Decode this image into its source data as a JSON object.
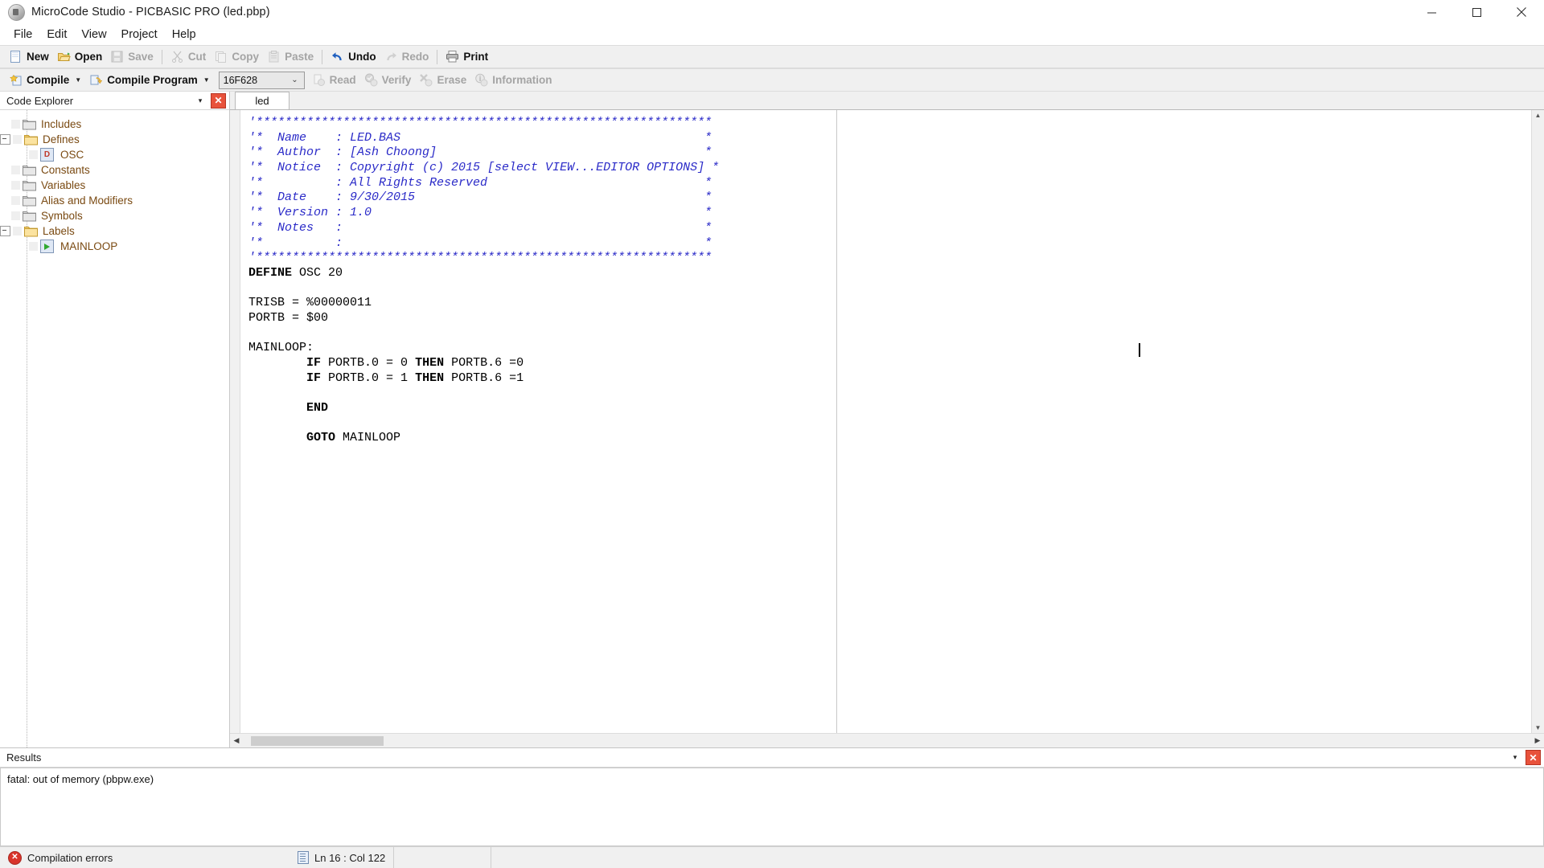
{
  "window": {
    "title": "MicroCode Studio - PICBASIC PRO (led.pbp)",
    "icon": "app-icon",
    "controls": {
      "minimize": "minimize-icon",
      "maximize": "maximize-icon",
      "close": "close-icon"
    }
  },
  "menubar": {
    "items": [
      {
        "label": "File"
      },
      {
        "label": "Edit"
      },
      {
        "label": "View"
      },
      {
        "label": "Project"
      },
      {
        "label": "Help"
      }
    ]
  },
  "toolbar_main": {
    "items": [
      {
        "label": "New",
        "icon": "new-file-icon",
        "enabled": true
      },
      {
        "label": "Open",
        "icon": "open-folder-icon",
        "enabled": true
      },
      {
        "label": "Save",
        "icon": "save-disk-icon",
        "enabled": false
      },
      {
        "sep": true
      },
      {
        "label": "Cut",
        "icon": "scissors-icon",
        "enabled": false
      },
      {
        "label": "Copy",
        "icon": "copy-icon",
        "enabled": false
      },
      {
        "label": "Paste",
        "icon": "clipboard-icon",
        "enabled": false
      },
      {
        "sep": true
      },
      {
        "label": "Undo",
        "icon": "undo-arrow-icon",
        "enabled": true
      },
      {
        "label": "Redo",
        "icon": "redo-arrow-icon",
        "enabled": false
      },
      {
        "sep": true
      },
      {
        "label": "Print",
        "icon": "printer-icon",
        "enabled": true
      }
    ]
  },
  "toolbar_compile": {
    "compile_label": "Compile",
    "compile_icon": "compile-icon",
    "compile_program_label": "Compile Program",
    "compile_program_icon": "compile-program-icon",
    "device_value": "16F628",
    "device_caret": "chevron-down-icon",
    "items": [
      {
        "label": "Read",
        "icon": "read-icon",
        "enabled": false
      },
      {
        "label": "Verify",
        "icon": "verify-check-icon",
        "enabled": false
      },
      {
        "label": "Erase",
        "icon": "erase-x-icon",
        "enabled": false
      },
      {
        "label": "Information",
        "icon": "information-icon",
        "enabled": false
      }
    ]
  },
  "explorer": {
    "title": "Code Explorer",
    "menu_icon": "chevron-down-icon",
    "close_icon": "close-icon",
    "close_label": "✕",
    "tree": [
      {
        "label": "Includes",
        "depth": 1,
        "twisty": "none",
        "icon": "folder-closed-icon"
      },
      {
        "label": "Defines",
        "depth": 1,
        "twisty": "expanded",
        "icon": "folder-open-icon"
      },
      {
        "label": "OSC",
        "depth": 2,
        "twisty": "none",
        "icon": "define-badge-icon"
      },
      {
        "label": "Constants",
        "depth": 1,
        "twisty": "none",
        "icon": "folder-closed-icon"
      },
      {
        "label": "Variables",
        "depth": 1,
        "twisty": "none",
        "icon": "folder-closed-icon"
      },
      {
        "label": "Alias and Modifiers",
        "depth": 1,
        "twisty": "none",
        "icon": "folder-closed-icon"
      },
      {
        "label": "Symbols",
        "depth": 1,
        "twisty": "none",
        "icon": "folder-closed-icon"
      },
      {
        "label": "Labels",
        "depth": 1,
        "twisty": "expanded",
        "icon": "folder-open-icon"
      },
      {
        "label": "MAINLOOP",
        "depth": 2,
        "twisty": "none",
        "icon": "label-play-icon"
      }
    ]
  },
  "editor": {
    "tabs": [
      {
        "label": "led",
        "active": true
      }
    ],
    "lines": [
      [
        {
          "t": "'***************************************************************",
          "c": "cmt"
        }
      ],
      [
        {
          "t": "'*  Name    : LED.BAS                                          *",
          "c": "cmt"
        }
      ],
      [
        {
          "t": "'*  Author  : [Ash Choong]                                     *",
          "c": "cmt"
        }
      ],
      [
        {
          "t": "'*  Notice  : Copyright (c) 2015 [select VIEW...EDITOR OPTIONS] *",
          "c": "cmt"
        }
      ],
      [
        {
          "t": "'*          : All Rights Reserved                              *",
          "c": "cmt"
        }
      ],
      [
        {
          "t": "'*  Date    : 9/30/2015                                        *",
          "c": "cmt"
        }
      ],
      [
        {
          "t": "'*  Version : 1.0                                              *",
          "c": "cmt"
        }
      ],
      [
        {
          "t": "'*  Notes   :                                                  *",
          "c": "cmt"
        }
      ],
      [
        {
          "t": "'*          :                                                  *",
          "c": "cmt"
        }
      ],
      [
        {
          "t": "'***************************************************************",
          "c": "cmt"
        }
      ],
      [
        {
          "t": "DEFINE",
          "c": "kw"
        },
        {
          "t": " OSC 20",
          "c": "pln"
        }
      ],
      [
        {
          "t": "",
          "c": "pln"
        }
      ],
      [
        {
          "t": "TRISB = %00000011",
          "c": "pln"
        }
      ],
      [
        {
          "t": "PORTB = $00",
          "c": "pln"
        }
      ],
      [
        {
          "t": "",
          "c": "pln"
        }
      ],
      [
        {
          "t": "MAINLOOP:",
          "c": "pln"
        }
      ],
      [
        {
          "t": "        ",
          "c": "pln"
        },
        {
          "t": "IF",
          "c": "kw"
        },
        {
          "t": " PORTB.0 = 0 ",
          "c": "pln"
        },
        {
          "t": "THEN",
          "c": "kw"
        },
        {
          "t": " PORTB.6 =0",
          "c": "pln"
        }
      ],
      [
        {
          "t": "        ",
          "c": "pln"
        },
        {
          "t": "IF",
          "c": "kw"
        },
        {
          "t": " PORTB.0 = 1 ",
          "c": "pln"
        },
        {
          "t": "THEN",
          "c": "kw"
        },
        {
          "t": " PORTB.6 =1",
          "c": "pln"
        }
      ],
      [
        {
          "t": "",
          "c": "pln"
        }
      ],
      [
        {
          "t": "        ",
          "c": "pln"
        },
        {
          "t": "END",
          "c": "kw"
        }
      ],
      [
        {
          "t": "",
          "c": "pln"
        }
      ],
      [
        {
          "t": "        ",
          "c": "pln"
        },
        {
          "t": "GOTO",
          "c": "kw"
        },
        {
          "t": " MAINLOOP",
          "c": "pln"
        }
      ]
    ]
  },
  "results": {
    "title": "Results",
    "menu_icon": "chevron-down-icon",
    "close_icon": "close-icon",
    "close_label": "✕",
    "output": "fatal: out of memory (pbpw.exe)"
  },
  "statusbar": {
    "error_icon": "error-circle-icon",
    "error_text": "Compilation errors",
    "position_icon": "line-col-icon",
    "position_text": "Ln 16 : Col 122"
  },
  "colors": {
    "comment": "#2b2bc8",
    "keyword": "#000000",
    "tree_text": "#7a4a12",
    "error_red": "#d9342b",
    "toolbar_bg": "#f0f0f0"
  }
}
